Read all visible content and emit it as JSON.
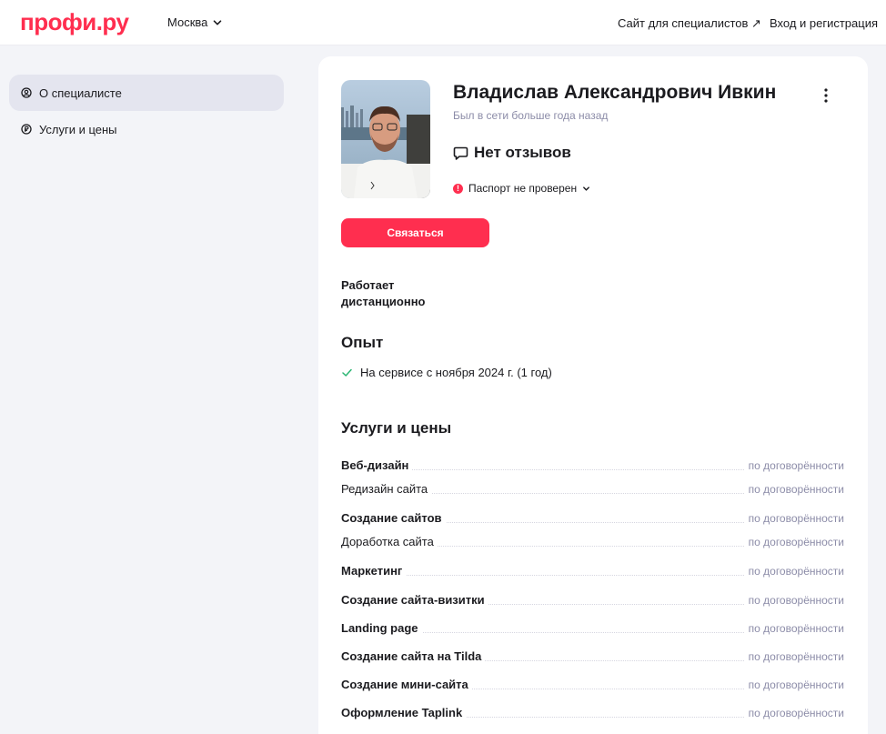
{
  "header": {
    "logo": "профи.ру",
    "city": "Москва",
    "specialists_link": "Сайт для специалистов ↗",
    "login_link": "Вход и регистрация"
  },
  "sidebar": {
    "items": [
      {
        "label": "О специалисте",
        "icon": "user-circle-icon",
        "active": true
      },
      {
        "label": "Услуги и цены",
        "icon": "ruble-icon",
        "active": false
      }
    ]
  },
  "profile": {
    "name": "Владислав Александрович Ивкин",
    "last_seen": "Был в сети больше года назад",
    "reviews": "Нет отзывов",
    "passport": "Паспорт не проверен",
    "contact_button": "Связаться",
    "work_mode": "Работает дистанционно"
  },
  "experience": {
    "title": "Опыт",
    "item": "На сервисе с ноября 2024 г. (1 год)"
  },
  "services": {
    "title": "Услуги и цены",
    "rows": [
      {
        "label": "Веб-дизайн",
        "price": "по договорённости",
        "category": true
      },
      {
        "label": "Редизайн сайта",
        "price": "по договорённости",
        "category": false
      },
      {
        "label": "Создание сайтов",
        "price": "по договорённости",
        "category": true
      },
      {
        "label": "Доработка сайта",
        "price": "по договорённости",
        "category": false
      },
      {
        "label": "Маркетинг",
        "price": "по договорённости",
        "category": true
      },
      {
        "label": "Создание сайта-визитки",
        "price": "по договорённости",
        "category": true
      },
      {
        "label": "Landing page",
        "price": "по договорённости",
        "category": true
      },
      {
        "label": "Создание сайта на Tilda",
        "price": "по договорённости",
        "category": true
      },
      {
        "label": "Создание мини-сайта",
        "price": "по договорённости",
        "category": true
      },
      {
        "label": "Оформление Taplink",
        "price": "по договорённости",
        "category": true
      }
    ]
  },
  "colors": {
    "accent": "#ff2e4f",
    "muted": "#8c8ca8",
    "background": "#f3f4f8",
    "check": "#2bb673"
  }
}
